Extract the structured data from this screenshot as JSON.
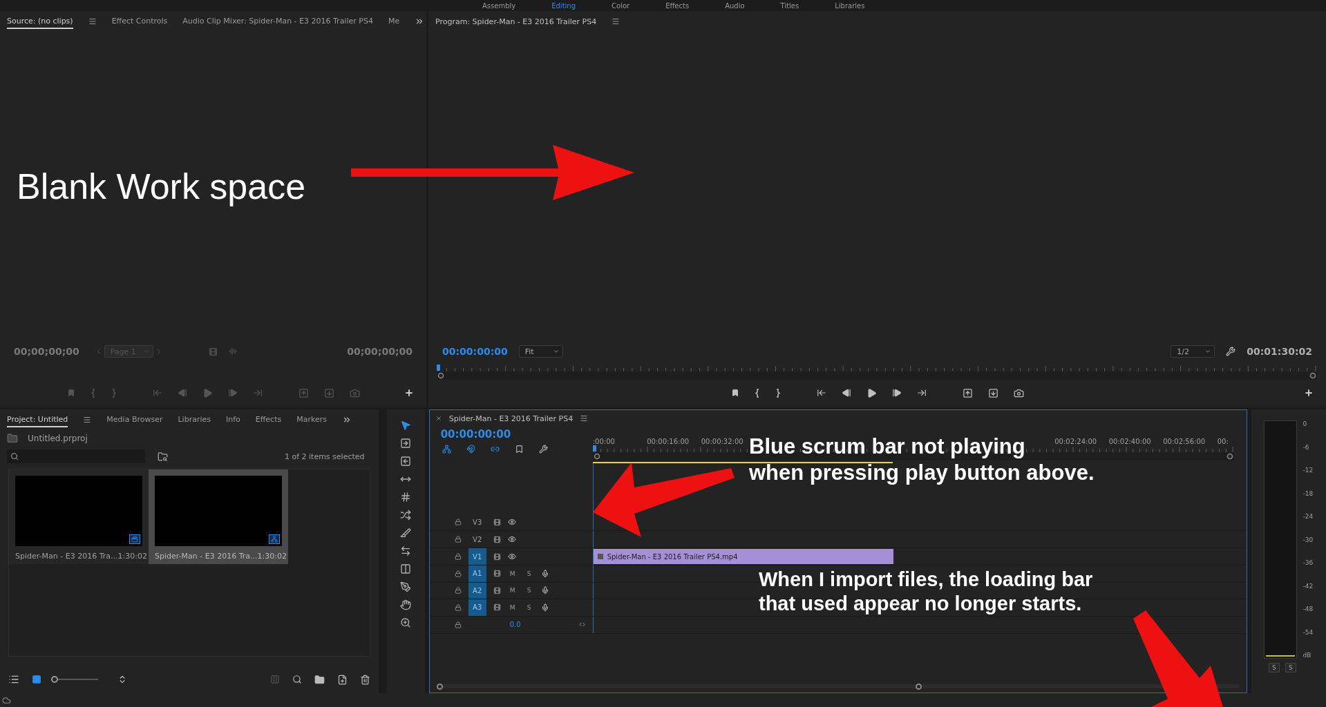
{
  "workspaces": [
    {
      "label": "Assembly",
      "selected": false
    },
    {
      "label": "Editing",
      "selected": true
    },
    {
      "label": "Color",
      "selected": false
    },
    {
      "label": "Effects",
      "selected": false
    },
    {
      "label": "Audio",
      "selected": false
    },
    {
      "label": "Titles",
      "selected": false
    },
    {
      "label": "Libraries",
      "selected": false
    }
  ],
  "source_panel": {
    "tabs": [
      {
        "label": "Source: (no clips)",
        "selected": true
      },
      {
        "label": "Effect Controls",
        "selected": false
      },
      {
        "label": "Audio Clip Mixer: Spider-Man - E3 2016 Trailer  PS4",
        "selected": false
      },
      {
        "label": "Me",
        "selected": false
      }
    ],
    "note": "Blank Work space",
    "timecode_in": "00;00;00;00",
    "page": "Page 1",
    "timecode_out": "00;00;00;00",
    "controls_disabled": true
  },
  "program_panel": {
    "title": "Program: Spider-Man - E3 2016 Trailer  PS4",
    "timecode": "00:00:00:00",
    "zoom": "Fit",
    "resolution": "1/2",
    "duration": "00:01:30:02",
    "controls_disabled": false
  },
  "project_panel": {
    "tabs": [
      {
        "label": "Project: Untitled",
        "selected": true
      },
      {
        "label": "Media Browser",
        "selected": false
      },
      {
        "label": "Libraries",
        "selected": false
      },
      {
        "label": "Info",
        "selected": false
      },
      {
        "label": "Effects",
        "selected": false
      },
      {
        "label": "Markers",
        "selected": false
      }
    ],
    "project_file": "Untitled.prproj",
    "selection_count": "1 of 2 items selected",
    "thumbnail_size": {
      "level": 0
    },
    "items": [
      {
        "name": "Spider-Man - E3 2016 Tra...",
        "duration": "1:30:02",
        "kind": "video",
        "selected": false
      },
      {
        "name": "Spider-Man - E3 2016 Tra...",
        "duration": "1:30:02",
        "kind": "sequence",
        "selected": true
      }
    ]
  },
  "tools": [
    {
      "kind": "select",
      "selected": true
    },
    {
      "kind": "track-forward",
      "selected": false
    },
    {
      "kind": "track-backward",
      "selected": false
    },
    {
      "kind": "ripple",
      "selected": false
    },
    {
      "kind": "rolling",
      "selected": false
    },
    {
      "kind": "rate",
      "selected": false
    },
    {
      "kind": "razor",
      "selected": false
    },
    {
      "kind": "slip",
      "selected": false
    },
    {
      "kind": "slide",
      "selected": false
    },
    {
      "kind": "pen",
      "selected": false
    },
    {
      "kind": "hand",
      "selected": false
    },
    {
      "kind": "zoom",
      "selected": false
    }
  ],
  "timeline": {
    "title": "Spider-Man - E3 2016 Trailer  PS4",
    "timecode": "00:00:00:00",
    "toggles": [
      {
        "kind": "nest",
        "on": true
      },
      {
        "kind": "snap",
        "on": true
      },
      {
        "kind": "linked",
        "on": true
      },
      {
        "kind": "marker",
        "on": false
      },
      {
        "kind": "settings",
        "on": false
      }
    ],
    "ruler_labels_start": [
      ":00:00",
      "00:00:16:00",
      "00:00:32:00"
    ],
    "ruler_labels_end": [
      "00:02:24:00",
      "00:02:40:00",
      "00:02:56:00",
      "00:"
    ],
    "tracks": [
      {
        "label": "V3",
        "kind": "video",
        "targeted": false
      },
      {
        "label": "V2",
        "kind": "video",
        "targeted": false
      },
      {
        "label": "V1",
        "kind": "video",
        "targeted": true,
        "clip": "Spider-Man - E3 2016 Trailer  PS4.mp4"
      },
      {
        "label": "A1",
        "kind": "audio",
        "targeted": true,
        "mute": "M",
        "solo": "S"
      },
      {
        "label": "A2",
        "kind": "audio",
        "targeted": true,
        "mute": "M",
        "solo": "S"
      },
      {
        "label": "A3",
        "kind": "audio",
        "targeted": true,
        "mute": "M",
        "solo": "S"
      }
    ],
    "master_level": "0.0"
  },
  "audio_meter": {
    "scale": [
      "0",
      "-6",
      "-12",
      "-18",
      "-24",
      "-30",
      "-36",
      "-42",
      "-48",
      "-54",
      "dB"
    ],
    "solo_buttons": [
      "S",
      "S"
    ]
  },
  "annotations": [
    {
      "lines": [
        "Blue scrum bar not playing",
        "when pressing play button above."
      ]
    },
    {
      "lines": [
        "When I import files, the loading bar",
        "that used appear no longer starts."
      ]
    }
  ]
}
